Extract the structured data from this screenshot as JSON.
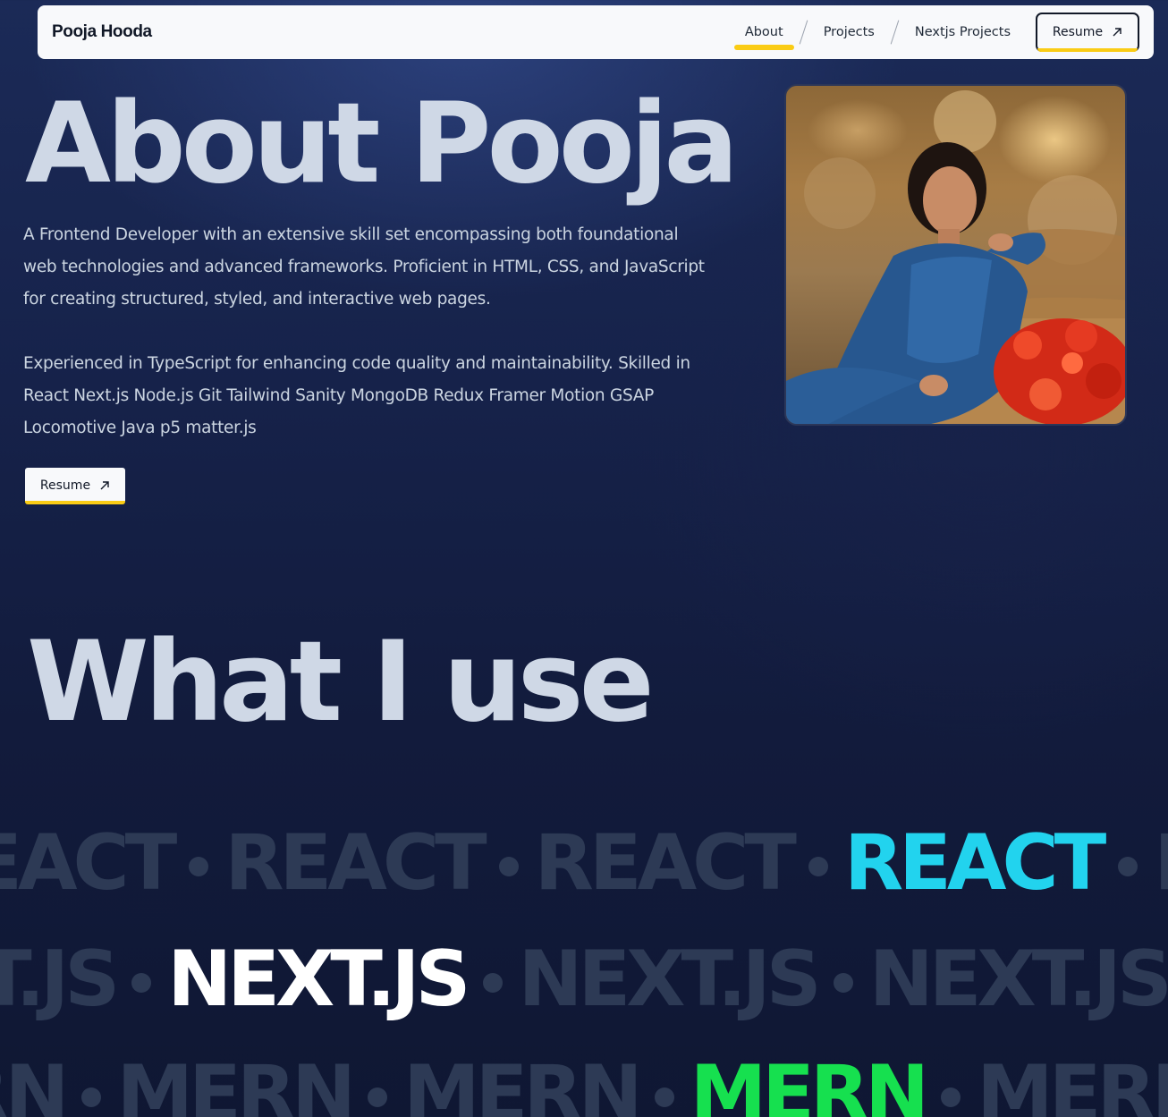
{
  "navbar": {
    "brand": "Pooja Hooda",
    "links": [
      {
        "label": "About",
        "active": true
      },
      {
        "label": "Projects",
        "active": false
      },
      {
        "label": "Nextjs Projects",
        "active": false
      }
    ],
    "resume_label": "Resume",
    "accent_color": "#facc15"
  },
  "hero": {
    "title": "About Pooja",
    "paragraph_1": "A Frontend Developer with an extensive skill set encompassing both foundational web technologies and advanced frameworks. Proficient in HTML, CSS, and JavaScript for creating structured, styled, and interactive web pages.",
    "paragraph_2": "Experienced in TypeScript for enhancing code quality and maintainability. Skilled in React Next.js Node.js Git Tailwind Sanity MongoDB Redux Framer Motion GSAP Locomotive Java p5 matter.js",
    "resume_label": "Resume",
    "arrow_icon": "arrow-up-right-icon"
  },
  "tools": {
    "title": "What I use",
    "rows": [
      {
        "word": "REACT",
        "highlight_color": "#22d3ee"
      },
      {
        "word": "NEXT.JS",
        "highlight_color": "#ffffff"
      },
      {
        "word": "MERN",
        "highlight_color": "#16e04f"
      }
    ],
    "dim_color": "#2d3a55"
  },
  "colors": {
    "background": "#16224a",
    "heading": "#cfd8e6",
    "accent": "#facc15"
  }
}
